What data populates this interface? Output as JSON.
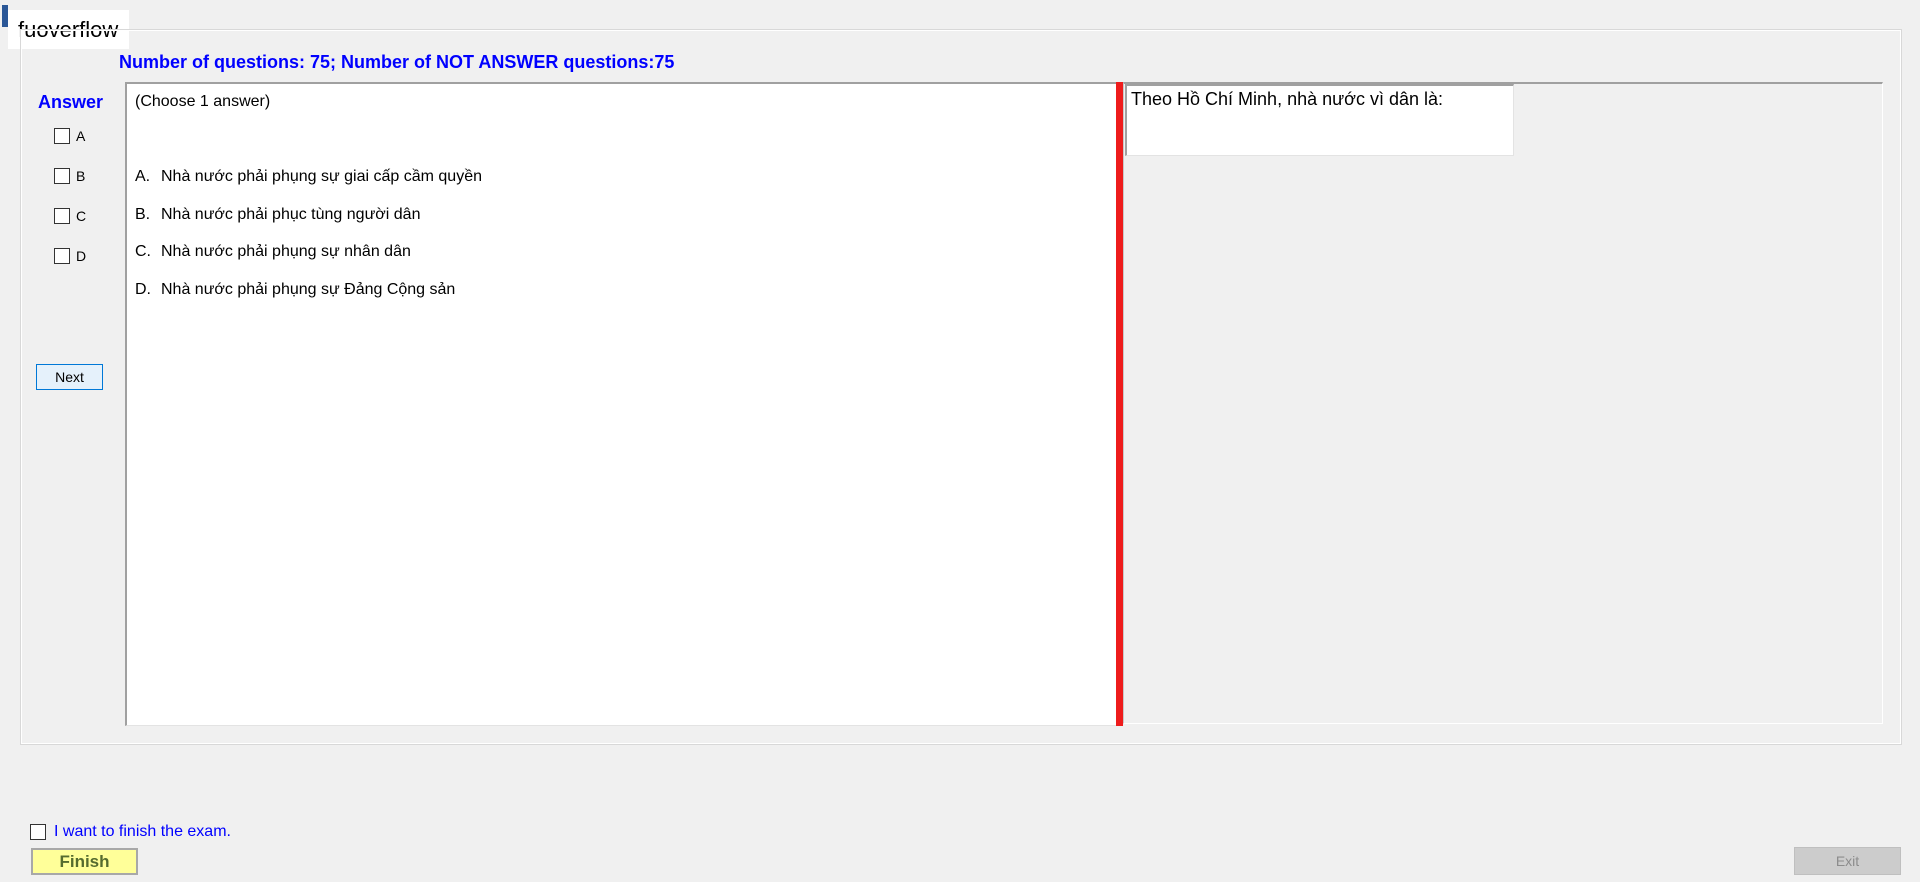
{
  "window": {
    "overlay_label": "fuoverflow"
  },
  "header": {
    "question_count": "Number of questions: 75; Number of NOT ANSWER questions:75"
  },
  "answer_panel": {
    "heading": "Answer",
    "options": [
      "A",
      "B",
      "C",
      "D"
    ],
    "next_label": "Next"
  },
  "choices": {
    "instruction": "(Choose 1 answer)",
    "items": [
      {
        "letter": "A.",
        "text": "Nhà nước phải phụng sự giai cấp cầm quyền"
      },
      {
        "letter": "B.",
        "text": "Nhà nước phải phục tùng người dân"
      },
      {
        "letter": "C.",
        "text": "Nhà nước phải phụng sự nhân dân"
      },
      {
        "letter": "D.",
        "text": "Nhà nước phải phụng sự Đảng Cộng sản"
      }
    ]
  },
  "question": {
    "text": "Theo Hồ Chí Minh, nhà nước vì dân là:"
  },
  "footer": {
    "finish_check_label": "I want to finish the exam.",
    "finish_label": "Finish",
    "exit_label": "Exit"
  },
  "colors": {
    "accent_blue": "#0000ff",
    "splitter_red": "#ee1c1c",
    "finish_yellow": "#ffff99"
  }
}
